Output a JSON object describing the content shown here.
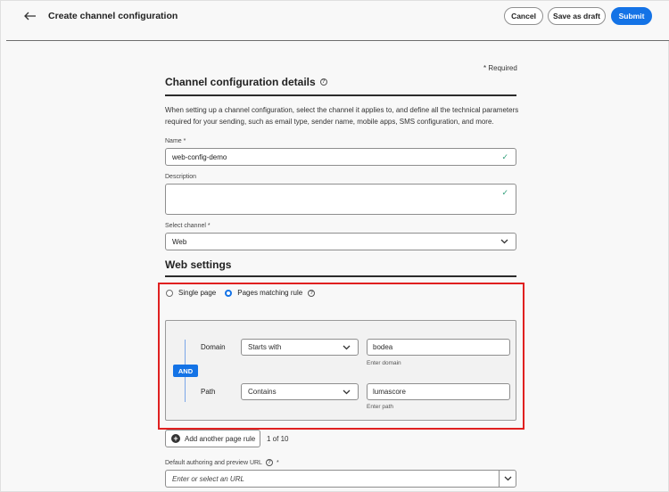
{
  "header": {
    "title": "Create channel configuration",
    "cancel_label": "Cancel",
    "draft_label": "Save as draft",
    "submit_label": "Submit"
  },
  "form": {
    "required_note": "* Required",
    "details_title": "Channel configuration details",
    "details_description": "When setting up a channel configuration, select the channel it applies to, and define all the technical parameters required for your sending, such as email type, sender name, mobile apps, SMS configuration, and more.",
    "name_label": "Name",
    "name_value": "web-config-demo",
    "description_label": "Description",
    "description_value": "",
    "channel_label": "Select channel",
    "channel_value": "Web",
    "required_marker": "*"
  },
  "web_settings": {
    "title": "Web settings",
    "option_single": "Single page",
    "option_matching": "Pages matching rule",
    "selected_option": "Pages matching rule",
    "and_label": "AND",
    "rules": [
      {
        "label": "Domain",
        "operator": "Starts with",
        "value": "bodea",
        "helper": "Enter domain"
      },
      {
        "label": "Path",
        "operator": "Contains",
        "value": "lumascore",
        "helper": "Enter path"
      }
    ],
    "add_rule_label": "Add another page rule",
    "rule_count": "1 of 10"
  },
  "url_field": {
    "label": "Default authoring and preview URL",
    "placeholder": "Enter or select an URL"
  },
  "colors": {
    "accent": "#1473e6",
    "highlight": "#e02020",
    "valid": "#2d9d78"
  },
  "icons": {
    "back": "arrow-left-icon",
    "help": "help-circle-icon",
    "check": "checkmark-icon",
    "chevron": "chevron-down-icon",
    "add": "add-circle-icon"
  }
}
